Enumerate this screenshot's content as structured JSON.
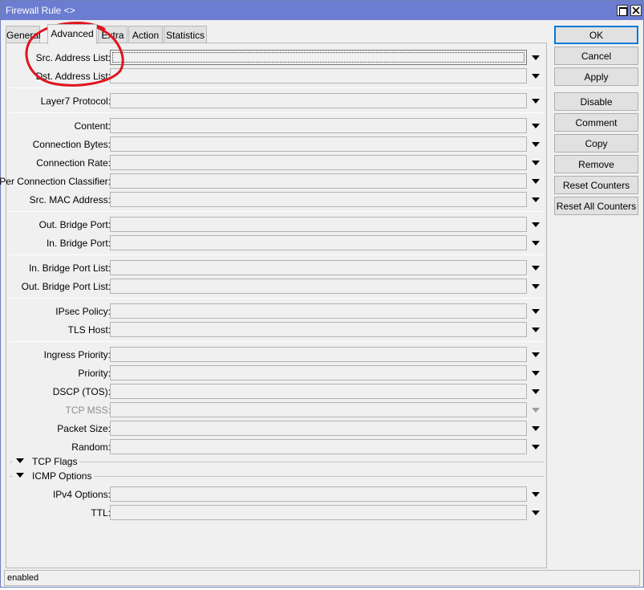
{
  "window": {
    "title": "Firewall Rule <>",
    "maximize_icon": "maximize-icon",
    "close_icon": "close-icon"
  },
  "tabs": [
    {
      "label": "General"
    },
    {
      "label": "Advanced",
      "active": true
    },
    {
      "label": "Extra"
    },
    {
      "label": "Action"
    },
    {
      "label": "Statistics"
    }
  ],
  "fields": {
    "src_address_list": {
      "label": "Src. Address List:",
      "value": ""
    },
    "dst_address_list": {
      "label": "Dst. Address List:",
      "value": ""
    },
    "layer7_protocol": {
      "label": "Layer7 Protocol:",
      "value": ""
    },
    "content": {
      "label": "Content:",
      "value": ""
    },
    "connection_bytes": {
      "label": "Connection Bytes:",
      "value": ""
    },
    "connection_rate": {
      "label": "Connection Rate:",
      "value": ""
    },
    "per_connection_classifier": {
      "label": "Per Connection Classifier:",
      "value": ""
    },
    "src_mac_address": {
      "label": "Src. MAC Address:",
      "value": ""
    },
    "out_bridge_port": {
      "label": "Out. Bridge Port:",
      "value": ""
    },
    "in_bridge_port": {
      "label": "In. Bridge Port:",
      "value": ""
    },
    "in_bridge_port_list": {
      "label": "In. Bridge Port List:",
      "value": ""
    },
    "out_bridge_port_list": {
      "label": "Out. Bridge Port List:",
      "value": ""
    },
    "ipsec_policy": {
      "label": "IPsec Policy:",
      "value": ""
    },
    "tls_host": {
      "label": "TLS Host:",
      "value": ""
    },
    "ingress_priority": {
      "label": "Ingress Priority:",
      "value": ""
    },
    "priority": {
      "label": "Priority:",
      "value": ""
    },
    "dscp_tos": {
      "label": "DSCP (TOS):",
      "value": ""
    },
    "tcp_mss": {
      "label": "TCP MSS:",
      "value": "",
      "disabled": true
    },
    "packet_size": {
      "label": "Packet Size:",
      "value": ""
    },
    "random": {
      "label": "Random:",
      "value": ""
    },
    "ipv4_options": {
      "label": "IPv4 Options:",
      "value": ""
    },
    "ttl": {
      "label": "TTL:",
      "value": ""
    }
  },
  "sections": {
    "tcp_flags": "TCP Flags",
    "icmp_options": "ICMP Options"
  },
  "buttons": {
    "ok": "OK",
    "cancel": "Cancel",
    "apply": "Apply",
    "disable": "Disable",
    "comment": "Comment",
    "copy": "Copy",
    "remove": "Remove",
    "reset_counters": "Reset Counters",
    "reset_all_counters": "Reset All Counters"
  },
  "status": "enabled",
  "colors": {
    "titlebar": "#6c7cd0",
    "annotation": "#e0141e",
    "default_button_border": "#0078d7"
  }
}
